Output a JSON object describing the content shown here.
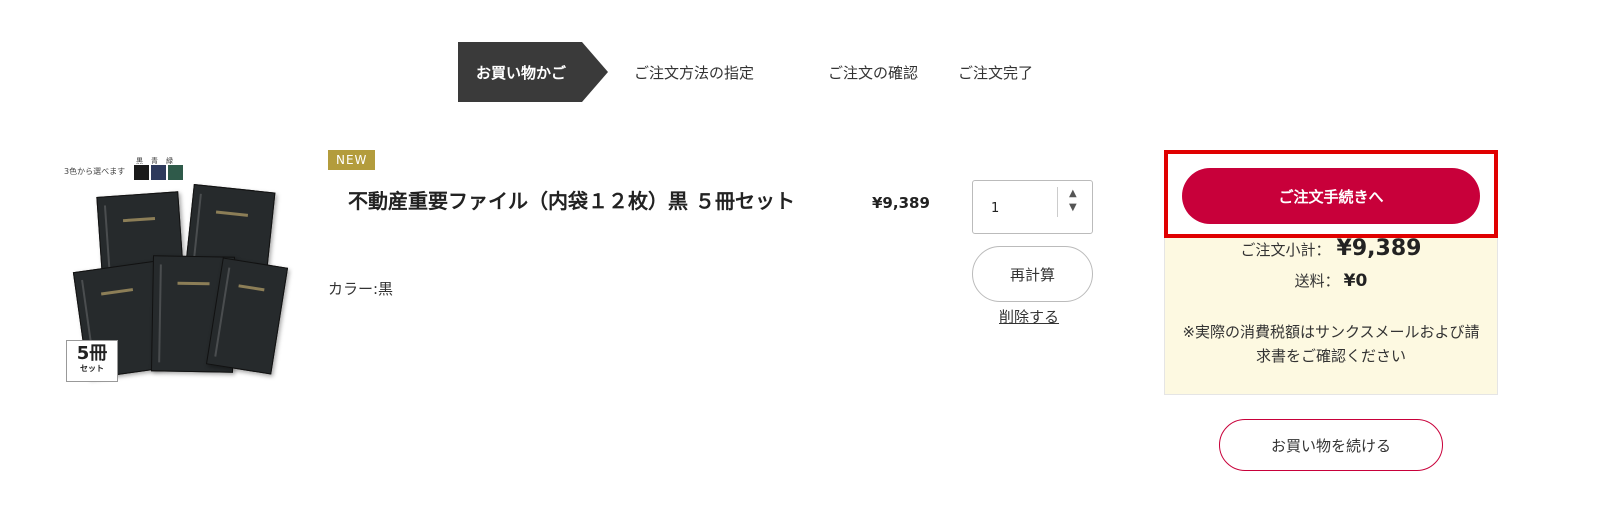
{
  "steps": [
    {
      "label": "お買い物かご",
      "active": true
    },
    {
      "label": "ご注文方法の指定",
      "active": false
    },
    {
      "label": "ご注文の確認",
      "active": false
    },
    {
      "label": "ご注文完了",
      "active": false
    }
  ],
  "product": {
    "image_caption": "3色から選べます",
    "swatch_labels": [
      "黒",
      "青",
      "緑"
    ],
    "swatch_colors": [
      "#1a1a1a",
      "#2e3a5c",
      "#2f5a4a"
    ],
    "set_badge_number": "5冊",
    "set_badge_text": "セット",
    "new_badge": "NEW",
    "name": "不動産重要ファイル（内袋１２枚）黒 ５冊セット",
    "color": "カラー:黒",
    "price": "¥9,389",
    "quantity": "1"
  },
  "actions": {
    "recalc_label": "再計算",
    "delete_label": "削除する",
    "checkout_label": "ご注文手続きへ",
    "continue_label": "お買い物を続ける"
  },
  "summary": {
    "subtotal_label": "ご注文小計：",
    "subtotal_value": "¥9,389",
    "shipping_label": "送料：",
    "shipping_value": "¥0",
    "tax_note": "※実際の消費税額はサンクスメールおよび請求書をご確認ください"
  },
  "colors": {
    "accent": "#c8003a",
    "highlight": "#e00000",
    "summary_bg": "#fdf9e1",
    "step_active_bg": "#3a3a3a",
    "new_badge_bg": "#b39c3c"
  }
}
